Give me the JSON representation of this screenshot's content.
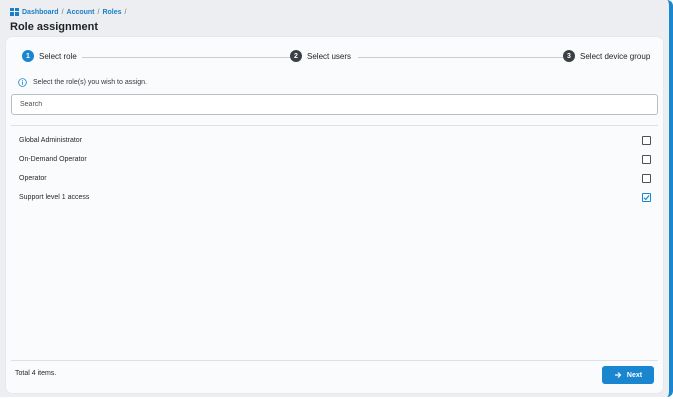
{
  "breadcrumb": {
    "icon": "dashboard-icon",
    "items": [
      "Dashboard",
      "Account",
      "Roles"
    ],
    "separator": "/"
  },
  "page_title": "Role assignment",
  "stepper": {
    "steps": [
      {
        "number": "1",
        "label": "Select role",
        "active": true
      },
      {
        "number": "2",
        "label": "Select users",
        "active": false
      },
      {
        "number": "3",
        "label": "Select device group",
        "active": false
      }
    ]
  },
  "info_text": "Select the role(s) you wish to assign.",
  "search": {
    "placeholder": "Search",
    "value": ""
  },
  "roles": [
    {
      "label": "Global Administrator",
      "checked": false
    },
    {
      "label": "On-Demand Operator",
      "checked": false
    },
    {
      "label": "Operator",
      "checked": false
    },
    {
      "label": "Support level 1 access",
      "checked": true
    }
  ],
  "footer": {
    "total_text": "Total 4 items."
  },
  "next_button": {
    "label": "Next",
    "icon": "arrow-right-icon"
  },
  "colors": {
    "accent": "#1a86d0",
    "step_inactive": "#3b4046",
    "background": "#eceef1",
    "card": "#fafbfc"
  }
}
